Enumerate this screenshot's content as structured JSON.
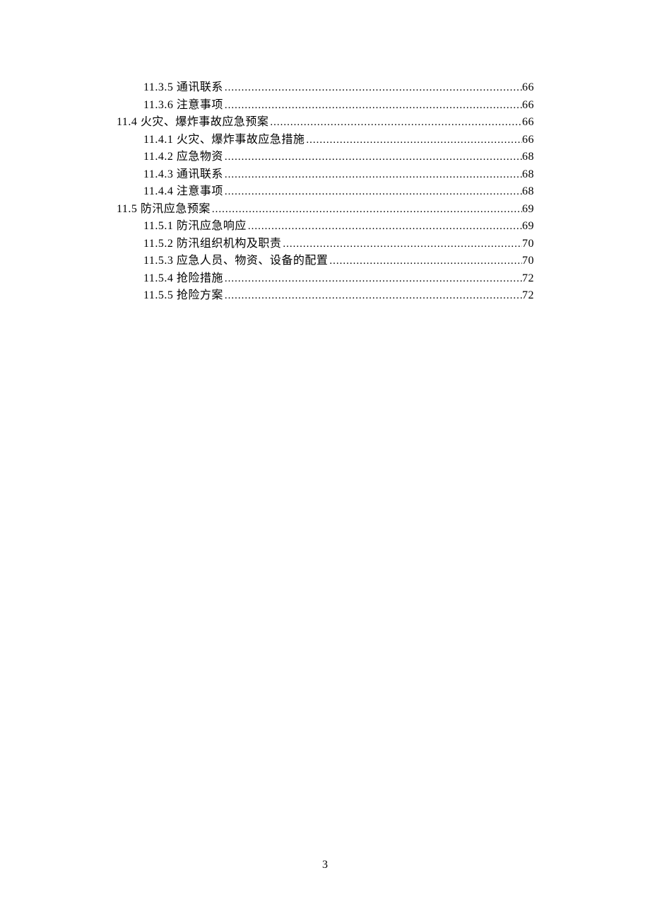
{
  "toc": [
    {
      "level": 2,
      "number": "11.3.5",
      "title": "通讯联系",
      "page": "66"
    },
    {
      "level": 2,
      "number": "11.3.6",
      "title": "注意事项",
      "page": "66"
    },
    {
      "level": 1,
      "number": "11.4",
      "title": "火灾、爆炸事故应急预案",
      "page": "66"
    },
    {
      "level": 2,
      "number": "11.4.1",
      "title": "火灾、爆炸事故应急措施",
      "page": "66"
    },
    {
      "level": 2,
      "number": "11.4.2",
      "title": "应急物资",
      "page": "68"
    },
    {
      "level": 2,
      "number": "11.4.3",
      "title": "通讯联系",
      "page": "68"
    },
    {
      "level": 2,
      "number": "11.4.4",
      "title": "注意事项",
      "page": "68"
    },
    {
      "level": 1,
      "number": "11.5",
      "title": "防汛应急预案",
      "page": "69"
    },
    {
      "level": 2,
      "number": "11.5.1",
      "title": "防汛应急响应",
      "page": "69"
    },
    {
      "level": 2,
      "number": "11.5.2",
      "title": "防汛组织机构及职责",
      "page": "70"
    },
    {
      "level": 2,
      "number": "11.5.3",
      "title": "应急人员、物资、设备的配置",
      "page": "70"
    },
    {
      "level": 2,
      "number": "11.5.4",
      "title": "抢险措施",
      "page": "72"
    },
    {
      "level": 2,
      "number": "11.5.5",
      "title": "抢险方案",
      "page": "72"
    }
  ],
  "pageNumber": "3"
}
